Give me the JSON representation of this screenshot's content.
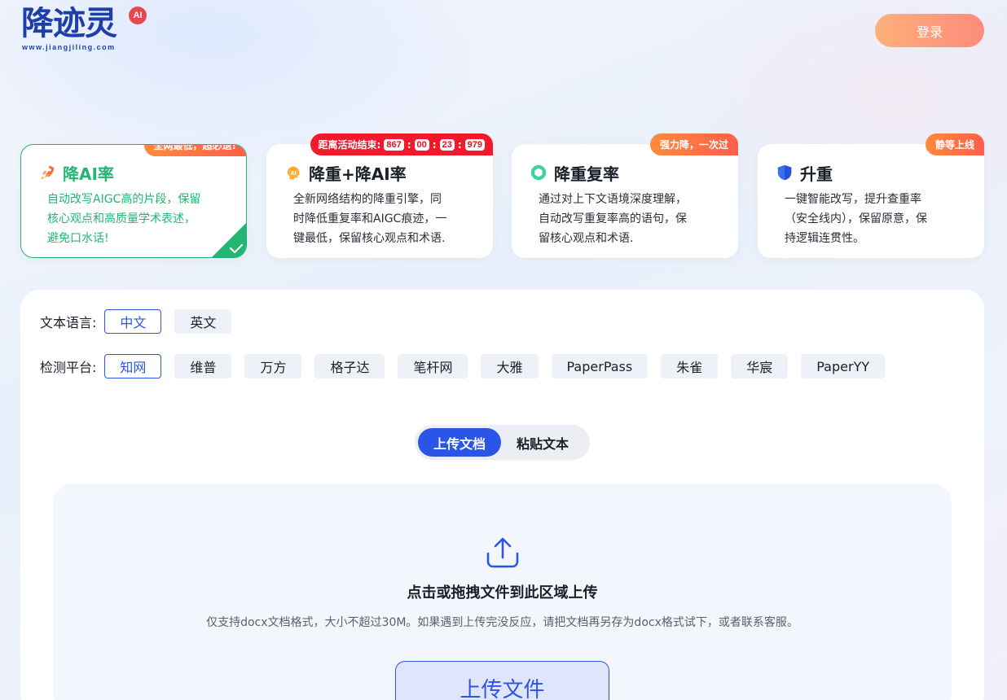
{
  "header": {
    "logo_text": "降迹灵",
    "logo_badge": "AI",
    "logo_url": "www.jiangjiling.com",
    "login_label": "登录"
  },
  "cards": [
    {
      "title": "降AI率",
      "badge": "全网最低，超必退!",
      "desc": [
        "自动改写AIGC高的片段，保留",
        "核心观点和高质量学术表述，",
        "避免口水话!"
      ],
      "icon": "rocket-icon",
      "active": true
    },
    {
      "title": "降重+降AI率",
      "badge_label": "距离活动结束:",
      "timer": [
        "867",
        "00",
        "23",
        "979"
      ],
      "desc": [
        "全新网络结构的降重引擎，同",
        "时降低重复率和AIGC痕迹，一",
        "键最低，保留核心观点和术语."
      ],
      "icon": "ai-head-icon"
    },
    {
      "title": "降重复率",
      "badge": "强力降，一次过",
      "desc": [
        "通过对上下文语境深度理解，",
        "自动改写重复率高的语句，保",
        "留核心观点和术语."
      ],
      "icon": "ring-icon"
    },
    {
      "title": "升重",
      "badge": "静等上线",
      "desc": [
        "一键智能改写，提升查重率",
        "（安全线内），保留原意，保",
        "持逻辑连贯性。"
      ],
      "icon": "shield-icon"
    }
  ],
  "options": {
    "language_label": "文本语言:",
    "languages": [
      "中文",
      "英文"
    ],
    "language_selected": 0,
    "platform_label": "检测平台:",
    "platforms": [
      "知网",
      "维普",
      "万方",
      "格子达",
      "笔杆网",
      "大雅",
      "PaperPass",
      "朱雀",
      "华宸",
      "PaperYY"
    ],
    "platform_selected": 0
  },
  "tabs": [
    "上传文档",
    "粘贴文本"
  ],
  "dropzone": {
    "title": "点击或拖拽文件到此区域上传",
    "subtitle": "仅支持docx文档格式，大小不超过30M。如果遇到上传完没反应，请把文档再另存为docx格式试下，或者联系客服。",
    "button_label": "上传文件"
  },
  "colors": {
    "primary": "#2b55e6",
    "green": "#22b573",
    "badge_orange": "#ff7043",
    "timer_red": "#f01a2a"
  }
}
